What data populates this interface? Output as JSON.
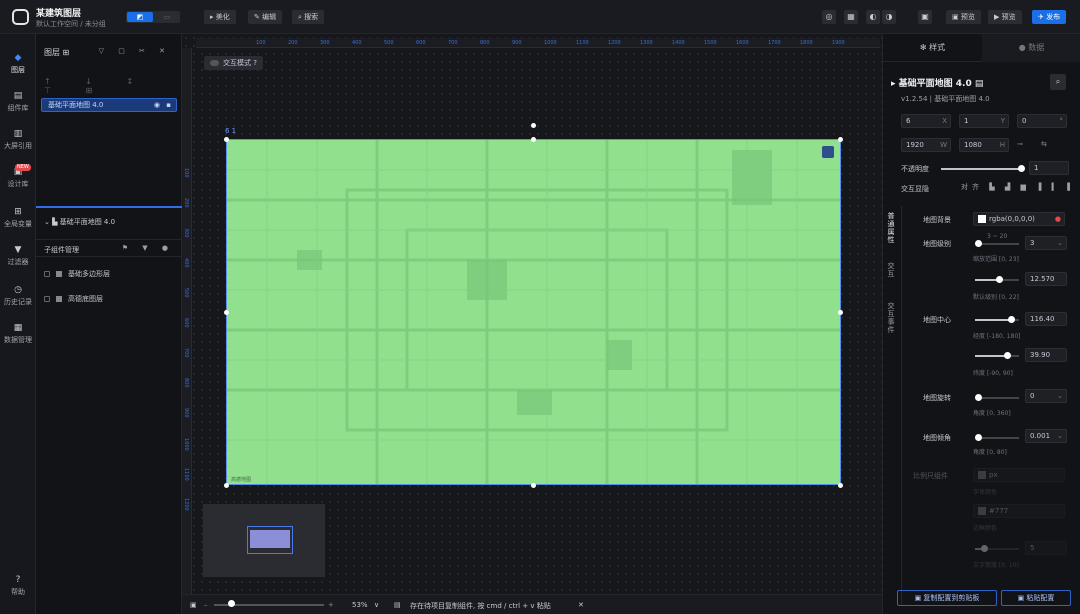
{
  "app": {
    "title": "某建筑图层",
    "subtitle": "默认工作空间 / 未分组",
    "mode_on": "◩",
    "mode_off": "▭"
  },
  "toolbar": {
    "beautify": "美化",
    "beautify_icon": "▸",
    "edit": "编辑",
    "edit_icon": "✎",
    "search": "搜索",
    "search_icon": "⌕",
    "icon_a": "◎",
    "icon_b": "▦",
    "icon_c": "◐",
    "icon_d": "◑",
    "share_icon": "▣",
    "share": "预览",
    "preview_icon": "▶",
    "preview": "预览",
    "publish_icon": "✈",
    "publish": "发布"
  },
  "rail": [
    {
      "icon": "◆",
      "label": "图层"
    },
    {
      "icon": "▤",
      "label": "组件库"
    },
    {
      "icon": "▥",
      "label": "大屏引用"
    },
    {
      "icon": "▣",
      "label": "设计库",
      "badge": "NEW"
    },
    {
      "icon": "⊞",
      "label": "全局变量"
    },
    {
      "icon": "▼",
      "label": "过滤器"
    },
    {
      "icon": "◷",
      "label": "历史记录"
    },
    {
      "icon": "▦",
      "label": "数据管理"
    },
    {
      "icon": "?",
      "label": "帮助"
    }
  ],
  "layers": {
    "title": "图层 ⊞",
    "head_icons": "▽ ▢ ✂ ✕",
    "tools": "↑ ↓ ↕ ⊤ ⊞",
    "selected": {
      "name": "基础平面地图 4.0",
      "eye": "◉",
      "lock": "▪"
    },
    "group": "基础平面地图 4.0",
    "sub_manage": "子组件管理",
    "sub_icons": "⚑ ▼ ●",
    "sub_items": [
      "基础多边形层",
      "高德底图层"
    ]
  },
  "canvas": {
    "interact_mode": "交互模式",
    "interact_help": "?",
    "selection_label": "6 1",
    "ruler_h": [
      "100",
      "200",
      "300",
      "400",
      "500",
      "600",
      "700",
      "800",
      "900",
      "1000",
      "1100",
      "1200",
      "1300",
      "1400",
      "1500",
      "1600",
      "1700",
      "1800",
      "1900"
    ],
    "ruler_v": [
      "100",
      "200",
      "300",
      "400",
      "500",
      "600",
      "700",
      "800",
      "900",
      "1000",
      "1100",
      "1200"
    ],
    "map_watermark": "高德地图"
  },
  "status": {
    "zoom": "53%",
    "zoom_caret": "∨",
    "hint": "存在待项目复制组件, 按 cmd / ctrl + v 粘贴",
    "close": "✕"
  },
  "rpanel": {
    "tab_style": "✻ 样式",
    "tab_data": "● 数据",
    "component_title": "基础平面地图 4.0 ▤",
    "version": "v1.2.54 | 基础平面地图 4.0",
    "search_icon": "⌕",
    "pos": {
      "x": "6",
      "x_u": "X",
      "y": "1",
      "y_u": "Y",
      "r": "0",
      "r_u": "°"
    },
    "size": {
      "w": "1920",
      "w_u": "W",
      "h": "1080",
      "h_u": "H"
    },
    "opacity_label": "不透明度",
    "opacity_value": "1",
    "opacity_pct": 1,
    "interact_label": "交互显隐",
    "align_icons": "对齐 ▙ ▟ ▆ ▐ ▍ ▌",
    "vtabs": [
      "普通属性",
      "交互",
      "交互事件"
    ],
    "map_bg_label": "地图背景",
    "map_bg_value": "rgba(0,0,0,0)",
    "map_level_label": "地图级别",
    "map_level_range_hint": "3 ~ 20",
    "map_level_value": "3",
    "map_level_pct": 0.0,
    "zoom_range_hint": "缩放范围 [0, 23]",
    "zoom_value": "12.570",
    "zoom_pct": 0.55,
    "default_level_hint": "默认级别 [0, 22]",
    "map_center_label": "地图中心",
    "lng_value": "116.40",
    "lng_pct": 0.82,
    "lng_hint": "经度 [-180, 180]",
    "lat_value": "39.90",
    "lat_pct": 0.72,
    "lat_hint": "纬度 [-90, 90]",
    "rotate_label": "地图旋转",
    "rotate_value": "0",
    "rotate_pct": 0.0,
    "rotate_hint": "角度 [0, 360]",
    "pitch_label": "地图倾角",
    "pitch_value": "0.001",
    "pitch_pct": 0.0,
    "pitch_hint": "角度 [0, 80]",
    "scale_label": "比例尺组件",
    "scale_value": "px",
    "scale_hint": "字体颜色",
    "color_value": "#777",
    "color_hint": "边框颜色",
    "font_value": "5",
    "font_hint": "文字宽度 [0, 10]",
    "btn_left": "▣ 复制配置到剪贴板",
    "btn_right": "▣ 粘贴配置"
  }
}
